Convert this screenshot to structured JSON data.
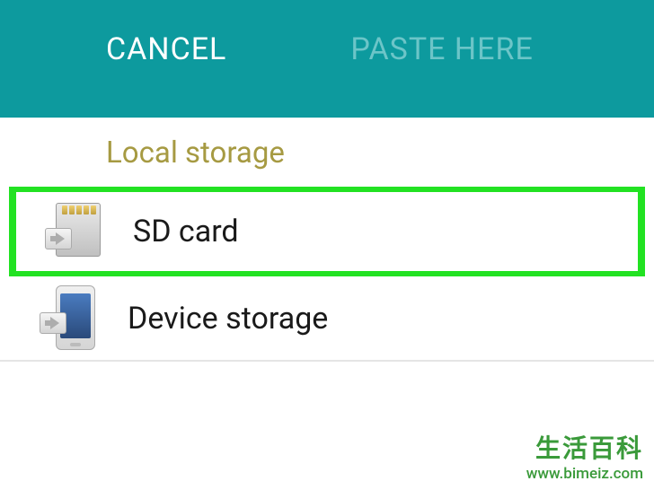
{
  "header": {
    "cancel_label": "CANCEL",
    "paste_label": "PASTE HERE"
  },
  "section": {
    "title": "Local storage"
  },
  "items": [
    {
      "label": "SD card",
      "highlighted": true,
      "icon": "sd-card-icon"
    },
    {
      "label": "Device storage",
      "highlighted": false,
      "icon": "device-icon"
    }
  ],
  "watermark": {
    "text_cn": "生活百科",
    "url": "www.bimeiz.com"
  },
  "colors": {
    "header_bg": "#0d9a9e",
    "highlight_border": "#22e222",
    "section_title": "#a69a42"
  }
}
